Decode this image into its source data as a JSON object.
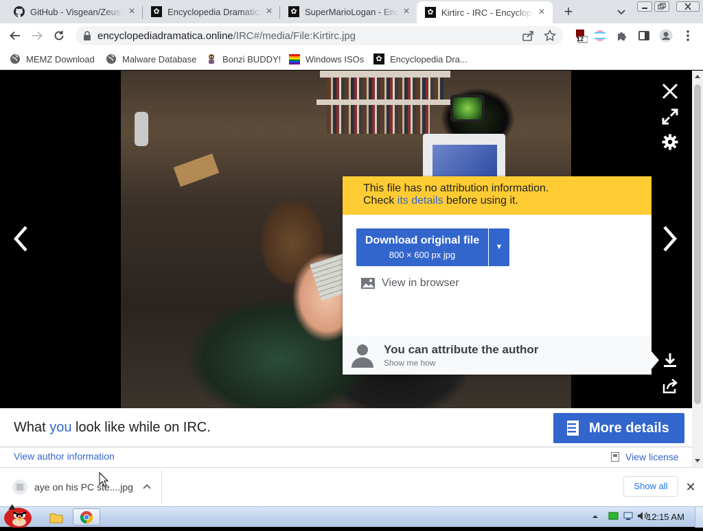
{
  "browser": {
    "tabs": [
      {
        "title": "GitHub - Visgean/Zeus: An",
        "favicon": "github-icon",
        "active": false
      },
      {
        "title": "Encyclopedia Dramatica",
        "favicon": "ed-icon",
        "active": false
      },
      {
        "title": "SuperMarioLogan - Encyclo",
        "favicon": "ed-icon",
        "active": false
      },
      {
        "title": "Kirtirc - IRC - Encyclopedia",
        "favicon": "ed-icon",
        "active": true
      }
    ],
    "address": {
      "domain": "encyclopediadramatica.online",
      "path": "/IRC#/media/File:Kirtirc.jpg"
    },
    "extension_badge": "12",
    "bookmarks": [
      {
        "label": "MEMZ Download",
        "icon": "globe-icon"
      },
      {
        "label": "Malware Database",
        "icon": "globe-icon"
      },
      {
        "label": "Bonzi BUDDY!",
        "icon": "bonzi-icon"
      },
      {
        "label": "Windows ISOs",
        "icon": "windows-flag-icon"
      },
      {
        "label": "Encyclopedia Dra...",
        "icon": "ed-icon"
      }
    ]
  },
  "download_dialog": {
    "notice_line1": "This file has no attribution information.",
    "notice_check": "Check ",
    "notice_link": "its details",
    "notice_after": " before using it.",
    "download_button": "Download original file",
    "download_subtitle": "800 × 600 px jpg",
    "view_in_browser": "View in browser",
    "attrib_title": "You can attribute the author",
    "attrib_subtitle": "Show me how"
  },
  "caption": {
    "before": "What ",
    "link": "you",
    "after": " look like while on IRC.",
    "more_details": "More details",
    "view_author": "View author information",
    "view_license": "View license"
  },
  "download_shelf": {
    "filename": "aye on his PC ste....jpg",
    "show_all": "Show all"
  },
  "taskbar": {
    "time": "12:15 AM"
  },
  "colors": {
    "accent": "#3366cc",
    "notice": "#ffcc33",
    "chrome_tabstrip": "#dee1e6"
  }
}
